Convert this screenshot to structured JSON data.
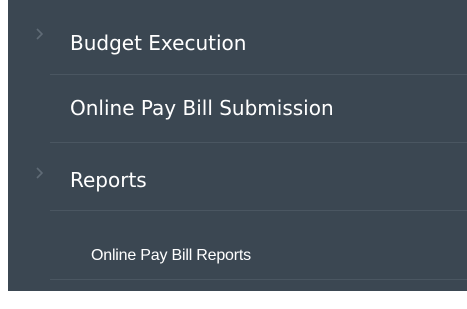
{
  "colors": {
    "sidebar_bg": "#3b4752",
    "divider": "#4a5661",
    "text": "#ffffff",
    "chevron": "#5f6b76"
  },
  "menu": {
    "items": [
      {
        "label": "Budget Execution",
        "icon": "chevron-right-icon",
        "has_submenu": true
      },
      {
        "label": "Online Pay Bill Submission",
        "icon": null,
        "has_submenu": false
      },
      {
        "label": "Reports",
        "icon": "chevron-right-icon",
        "has_submenu": true
      },
      {
        "label": "Online Pay Bill Reports",
        "icon": null,
        "has_submenu": false,
        "level": 2
      }
    ]
  }
}
